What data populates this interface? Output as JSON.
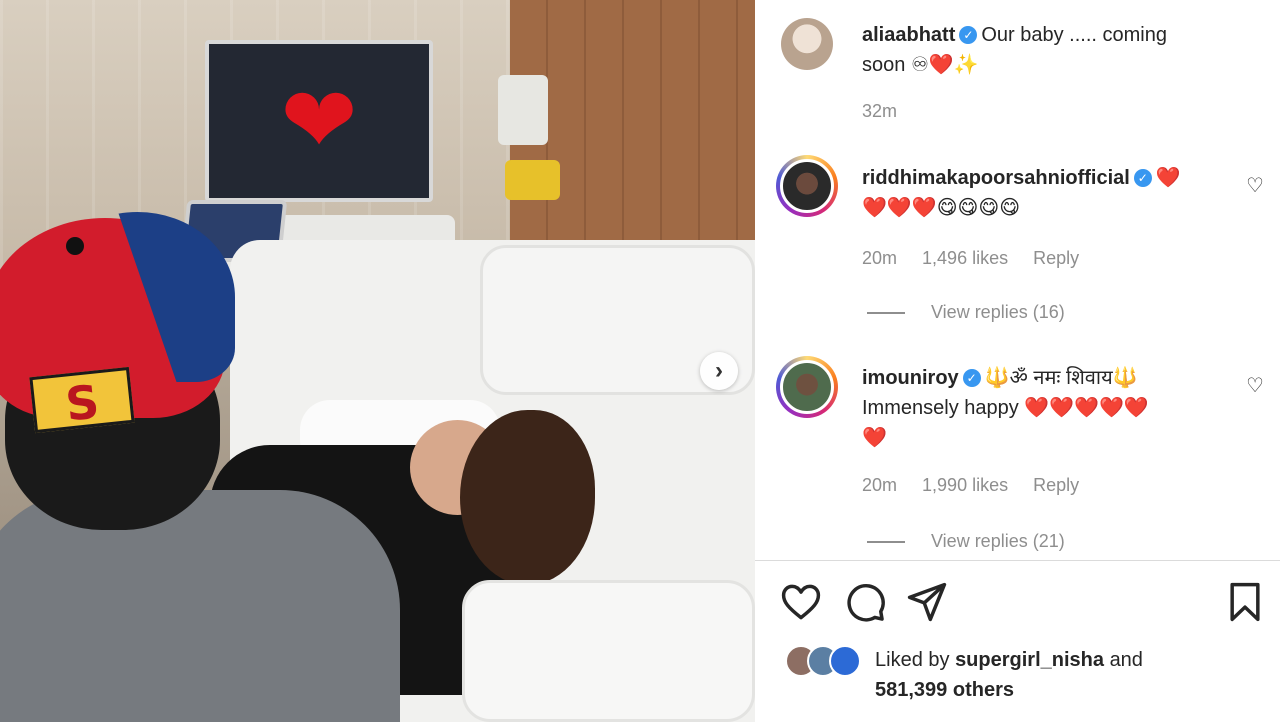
{
  "post": {
    "author": "aliaabhatt",
    "caption": "Our baby ..... coming",
    "caption_line2": "soon",
    "caption_emojis": "♾❤️✨",
    "time": "32m"
  },
  "photo": {
    "cap_logo": "S",
    "next_icon": "chevron-right-icon"
  },
  "comments": [
    {
      "username": "riddhimakapoorsahniofficial",
      "text_line1": "❤️",
      "text_line2": "❤️❤️❤️😋😋😋😋",
      "time": "20m",
      "likes": "1,496 likes",
      "reply": "Reply",
      "view_replies": "View replies (16)"
    },
    {
      "username": "imouniroy",
      "text_line1": "🔱ॐ नमः शिवाय🔱",
      "text_line2": "Immensely happy ❤️❤️❤️❤️❤️",
      "text_line3": "❤️",
      "time": "20m",
      "likes": "1,990 likes",
      "reply": "Reply",
      "view_replies": "View replies (21)"
    }
  ],
  "likes": {
    "prefix": "Liked by",
    "user": "supergirl_nisha",
    "and": "and",
    "others": "581,399 others"
  },
  "colors": {
    "heart": "#e0202e",
    "verified": "#3897f0",
    "muted": "#8e8e8e"
  }
}
